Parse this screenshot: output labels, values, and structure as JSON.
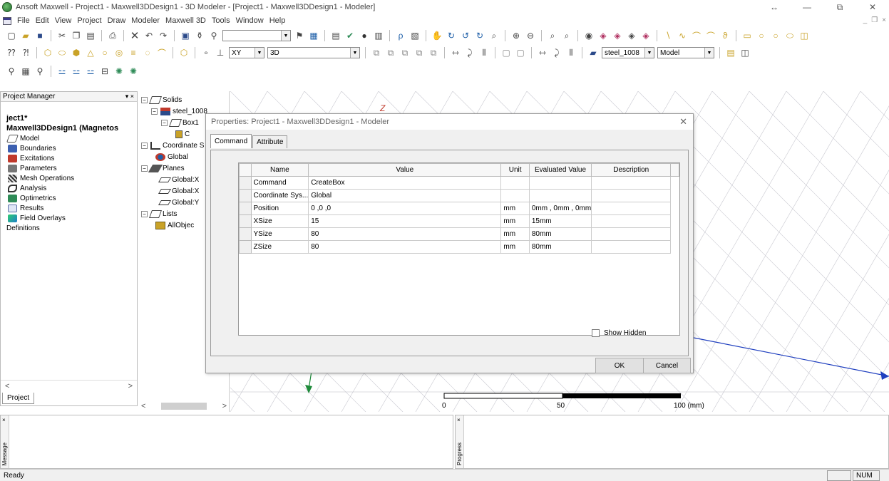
{
  "titlebar": {
    "title": "Ansoft Maxwell - Project1 - Maxwell3DDesign1 - 3D Modeler - [Project1 - Maxwell3DDesign1 - Modeler]",
    "restore_glyph": "↔",
    "minimize_glyph": "—",
    "maximize_glyph": "⧉",
    "close_glyph": "✕"
  },
  "menubar": {
    "items": [
      "File",
      "Edit",
      "View",
      "Project",
      "Draw",
      "Modeler",
      "Maxwell 3D",
      "Tools",
      "Window",
      "Help"
    ],
    "mdi_minimize": "_",
    "mdi_restore": "❐",
    "mdi_close": "×"
  },
  "toolbar": {
    "plane_select": "XY",
    "dim_select": "3D",
    "material_select": "steel_1008",
    "model_select": "Model"
  },
  "project_manager": {
    "header": "Project Manager",
    "header_controls": "▾ ×",
    "items": [
      {
        "label": "ject1*",
        "bold": true
      },
      {
        "label": "Maxwell3DDesign1 (Magnetos",
        "bold": true
      },
      {
        "label": "Model",
        "icon": "model-icon",
        "color": "#6a6a6a"
      },
      {
        "label": "Boundaries",
        "icon": "boundaries-icon",
        "color": "#3c5fb0"
      },
      {
        "label": "Excitations",
        "icon": "excitations-icon",
        "color": "#c0392b"
      },
      {
        "label": "Parameters",
        "icon": "parameters-icon",
        "color": "#555555"
      },
      {
        "label": "Mesh Operations",
        "icon": "mesh-operations-icon",
        "color": "#444444"
      },
      {
        "label": "Analysis",
        "icon": "analysis-icon",
        "color": "#3a3a3a"
      },
      {
        "label": "Optimetrics",
        "icon": "optimetrics-icon",
        "color": "#2e8b57"
      },
      {
        "label": "Results",
        "icon": "results-icon",
        "color": "#5a6fa8"
      },
      {
        "label": "Field Overlays",
        "icon": "field-overlays-icon",
        "color": "#1e7fc9"
      },
      {
        "label": "Definitions",
        "icon": "",
        "color": ""
      }
    ],
    "tab": "Project",
    "scroll_left": "<",
    "scroll_right": ">"
  },
  "model_tree": {
    "rows": [
      {
        "label": "Solids",
        "indent": 4,
        "exp": "−",
        "icon": "solids-icon"
      },
      {
        "label": "steel_1008",
        "indent": 18,
        "exp": "−",
        "icon": "material-icon"
      },
      {
        "label": "Box1",
        "indent": 32,
        "exp": "−",
        "icon": "box-icon"
      },
      {
        "label": "C",
        "indent": 52,
        "exp": "",
        "icon": "command-icon"
      },
      {
        "label": "Coordinate S",
        "indent": 4,
        "exp": "−",
        "icon": "coordinate-system-icon"
      },
      {
        "label": "Global",
        "indent": 24,
        "exp": "",
        "icon": "global-cs-icon"
      },
      {
        "label": "Planes",
        "indent": 4,
        "exp": "−",
        "icon": "planes-icon"
      },
      {
        "label": "Global:X",
        "indent": 30,
        "exp": "",
        "icon": "plane-icon"
      },
      {
        "label": "Global:X",
        "indent": 30,
        "exp": "",
        "icon": "plane-icon"
      },
      {
        "label": "Global:Y",
        "indent": 30,
        "exp": "",
        "icon": "plane-icon"
      },
      {
        "label": "Lists",
        "indent": 4,
        "exp": "−",
        "icon": "lists-icon"
      },
      {
        "label": "AllObjec",
        "indent": 24,
        "exp": "",
        "icon": "all-objects-icon"
      }
    ],
    "scroll_left": "<",
    "scroll_right": ">"
  },
  "viewport": {
    "axis_z_label": "Z",
    "scale_labels": [
      "0",
      "50",
      "100 (mm)"
    ]
  },
  "dialog": {
    "title": "Properties: Project1 - Maxwell3DDesign1 - Modeler",
    "close_glyph": "✕",
    "tabs": [
      "Command",
      "Attribute"
    ],
    "columns": [
      "Name",
      "Value",
      "Unit",
      "Evaluated Value",
      "Description"
    ],
    "rows": [
      {
        "name": "Command",
        "value": "CreateBox",
        "unit": "",
        "evaluated": "",
        "description": ""
      },
      {
        "name": "Coordinate Sys...",
        "value": "Global",
        "unit": "",
        "evaluated": "",
        "description": ""
      },
      {
        "name": "Position",
        "value": "0 ,0 ,0",
        "unit": "mm",
        "evaluated": "0mm , 0mm , 0mm",
        "description": ""
      },
      {
        "name": "XSize",
        "value": "15",
        "unit": "mm",
        "evaluated": "15mm",
        "description": ""
      },
      {
        "name": "YSize",
        "value": "80",
        "unit": "mm",
        "evaluated": "80mm",
        "description": ""
      },
      {
        "name": "ZSize",
        "value": "80",
        "unit": "mm",
        "evaluated": "80mm",
        "description": ""
      }
    ],
    "show_hidden_label": "Show Hidden",
    "ok_label": "OK",
    "cancel_label": "Cancel"
  },
  "bottom": {
    "message_label": "Message",
    "progress_label": "Progress",
    "close_glyph": "×"
  },
  "status": {
    "text": "Ready",
    "num": "NUM"
  }
}
